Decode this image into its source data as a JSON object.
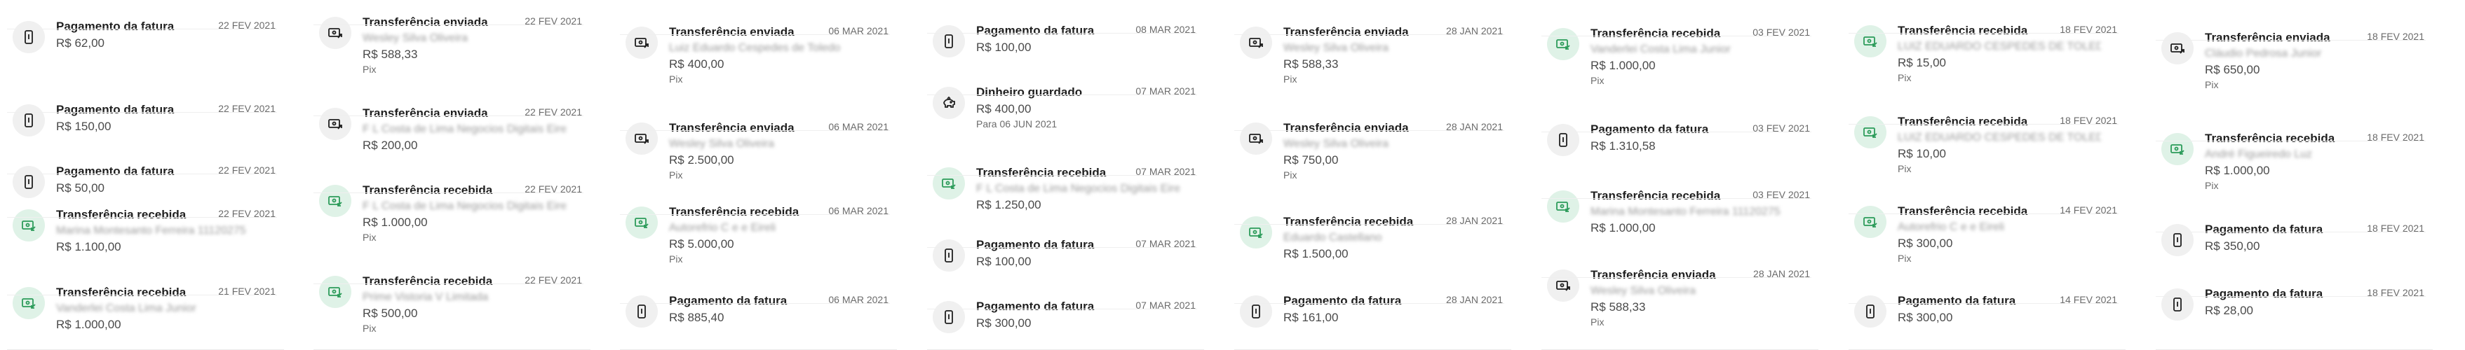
{
  "icons": {
    "invoice": "phone-invoice-icon",
    "transfer_sent": "money-out-icon",
    "transfer_received": "money-in-icon",
    "savings": "piggy-bank-icon"
  },
  "colors": {
    "icon_bg": "#f0f0f0",
    "received_bg": "#dff2e7",
    "received_fg": "#2c9b5a",
    "text": "#1f1f1f",
    "muted": "#6b6b6b"
  },
  "columns": [
    {
      "items": [
        {
          "kind": "invoice",
          "title": "Pagamento da fatura",
          "date": "22 FEV 2021",
          "amount": "R$ 62,00"
        },
        {
          "kind": "invoice",
          "title": "Pagamento da fatura",
          "date": "22 FEV 2021",
          "amount": "R$ 150,00"
        },
        {
          "kind": "invoice",
          "title": "Pagamento da fatura",
          "date": "22 FEV 2021",
          "amount": "R$ 50,00"
        },
        {
          "kind": "received",
          "title": "Transferência recebida",
          "date": "22 FEV 2021",
          "name": "Marina Montesanto Ferreira 11120275",
          "amount": "R$ 1.100,00"
        },
        {
          "kind": "received",
          "title": "Transferência recebida",
          "date": "21 FEV 2021",
          "name": "Vanderlei Costa Lima Junior",
          "amount": "R$ 1.000,00"
        }
      ]
    },
    {
      "items": [
        {
          "kind": "sent",
          "title": "Transferência enviada",
          "date": "22 FEV 2021",
          "name": "Wesley Silva Oliveira",
          "amount": "R$ 588,33",
          "sub": "Pix"
        },
        {
          "kind": "sent",
          "title": "Transferência enviada",
          "date": "22 FEV 2021",
          "name": "F L Costa de Lima Negocios Digitais Eireli",
          "amount": "R$ 200,00"
        },
        {
          "kind": "received",
          "title": "Transferência recebida",
          "date": "22 FEV 2021",
          "name": "F L Costa de Lima Negocios Digitais Eireli",
          "amount": "R$ 1.000,00",
          "sub": "Pix"
        },
        {
          "kind": "received",
          "title": "Transferência recebida",
          "date": "22 FEV 2021",
          "name": "Prime Vistoria V Limitada",
          "amount": "R$ 500,00",
          "sub": "Pix"
        }
      ]
    },
    {
      "items": [
        {
          "kind": "sent",
          "title": "Transferência enviada",
          "date": "06 MAR 2021",
          "name": "Luiz Eduardo Cespedes de Toledo",
          "amount": "R$ 400,00",
          "sub": "Pix"
        },
        {
          "kind": "sent",
          "title": "Transferência enviada",
          "date": "06 MAR 2021",
          "name": "Wesley Silva Oliveira",
          "amount": "R$ 2.500,00",
          "sub": "Pix"
        },
        {
          "kind": "received",
          "title": "Transferência recebida",
          "date": "06 MAR 2021",
          "name": "Autorefrio C e e Eireli",
          "amount": "R$ 5.000,00",
          "sub": "Pix"
        },
        {
          "kind": "invoice",
          "title": "Pagamento da fatura",
          "date": "06 MAR 2021",
          "amount": "R$ 885,40"
        }
      ]
    },
    {
      "items": [
        {
          "kind": "invoice",
          "title": "Pagamento da fatura",
          "date": "08 MAR 2021",
          "amount": "R$ 100,00"
        },
        {
          "kind": "savings",
          "title": "Dinheiro guardado",
          "date": "07 MAR 2021",
          "amount": "R$ 400,00",
          "sub": "Para 06 JUN 2021"
        },
        {
          "kind": "received",
          "title": "Transferência recebida",
          "date": "07 MAR 2021",
          "name": "F L Costa de Lima Negocios Digitais Eireli",
          "amount": "R$ 1.250,00"
        },
        {
          "kind": "invoice",
          "title": "Pagamento da fatura",
          "date": "07 MAR 2021",
          "amount": "R$ 100,00"
        },
        {
          "kind": "invoice",
          "title": "Pagamento da fatura",
          "date": "07 MAR 2021",
          "amount": "R$ 300,00"
        }
      ]
    },
    {
      "items": [
        {
          "kind": "sent",
          "title": "Transferência enviada",
          "date": "28 JAN 2021",
          "name": "Wesley Silva Oliveira",
          "amount": "R$ 588,33",
          "sub": "Pix"
        },
        {
          "kind": "sent",
          "title": "Transferência enviada",
          "date": "28 JAN 2021",
          "name": "Wesley Silva Oliveira",
          "amount": "R$ 750,00",
          "sub": "Pix"
        },
        {
          "kind": "received",
          "title": "Transferência recebida",
          "date": "28 JAN 2021",
          "name": "Eduardo Castellano",
          "amount": "R$ 1.500,00"
        },
        {
          "kind": "invoice",
          "title": "Pagamento da fatura",
          "date": "28 JAN 2021",
          "amount": "R$ 161,00"
        }
      ]
    },
    {
      "items": [
        {
          "kind": "received",
          "title": "Transferência recebida",
          "date": "03 FEV 2021",
          "name": "Vanderlei Costa Lima Junior",
          "amount": "R$ 1.000,00",
          "sub": "Pix"
        },
        {
          "kind": "invoice",
          "title": "Pagamento da fatura",
          "date": "03 FEV 2021",
          "amount": "R$ 1.310,58"
        },
        {
          "kind": "received",
          "title": "Transferência recebida",
          "date": "03 FEV 2021",
          "name": "Marina Montesanto Ferreira 11120275",
          "amount": "R$ 1.000,00"
        },
        {
          "kind": "sent",
          "title": "Transferência enviada",
          "date": "28 JAN 2021",
          "name": "Wesley Silva Oliveira",
          "amount": "R$ 588,33",
          "sub": "Pix"
        }
      ]
    },
    {
      "items": [
        {
          "kind": "received",
          "title": "Transferência recebida",
          "date": "18 FEV 2021",
          "name": "LUIZ EDUARDO CESPEDES DE TOLEDO",
          "amount": "R$ 15,00",
          "sub": "Pix"
        },
        {
          "kind": "received",
          "title": "Transferência recebida",
          "date": "18 FEV 2021",
          "name": "LUIZ EDUARDO CESPEDES DE TOLEDO",
          "amount": "R$ 10,00",
          "sub": "Pix"
        },
        {
          "kind": "received",
          "title": "Transferência recebida",
          "date": "14 FEV 2021",
          "name": "Autorefrio C e e Eireli",
          "amount": "R$ 300,00",
          "sub": "Pix"
        },
        {
          "kind": "invoice",
          "title": "Pagamento da fatura",
          "date": "14 FEV 2021",
          "amount": "R$ 300,00"
        }
      ]
    },
    {
      "items": [
        {
          "kind": "sent",
          "title": "Transferência enviada",
          "date": "18 FEV 2021",
          "name": "Cláudio Pedrosa Junior",
          "amount": "R$ 650,00",
          "sub": "Pix"
        },
        {
          "kind": "received",
          "title": "Transferência recebida",
          "date": "18 FEV 2021",
          "name": "André Figueiredo Luz",
          "amount": "R$ 1.000,00",
          "sub": "Pix"
        },
        {
          "kind": "invoice",
          "title": "Pagamento da fatura",
          "date": "18 FEV 2021",
          "amount": "R$ 350,00"
        },
        {
          "kind": "invoice",
          "title": "Pagamento da fatura",
          "date": "18 FEV 2021",
          "amount": "R$ 28,00"
        }
      ]
    }
  ]
}
